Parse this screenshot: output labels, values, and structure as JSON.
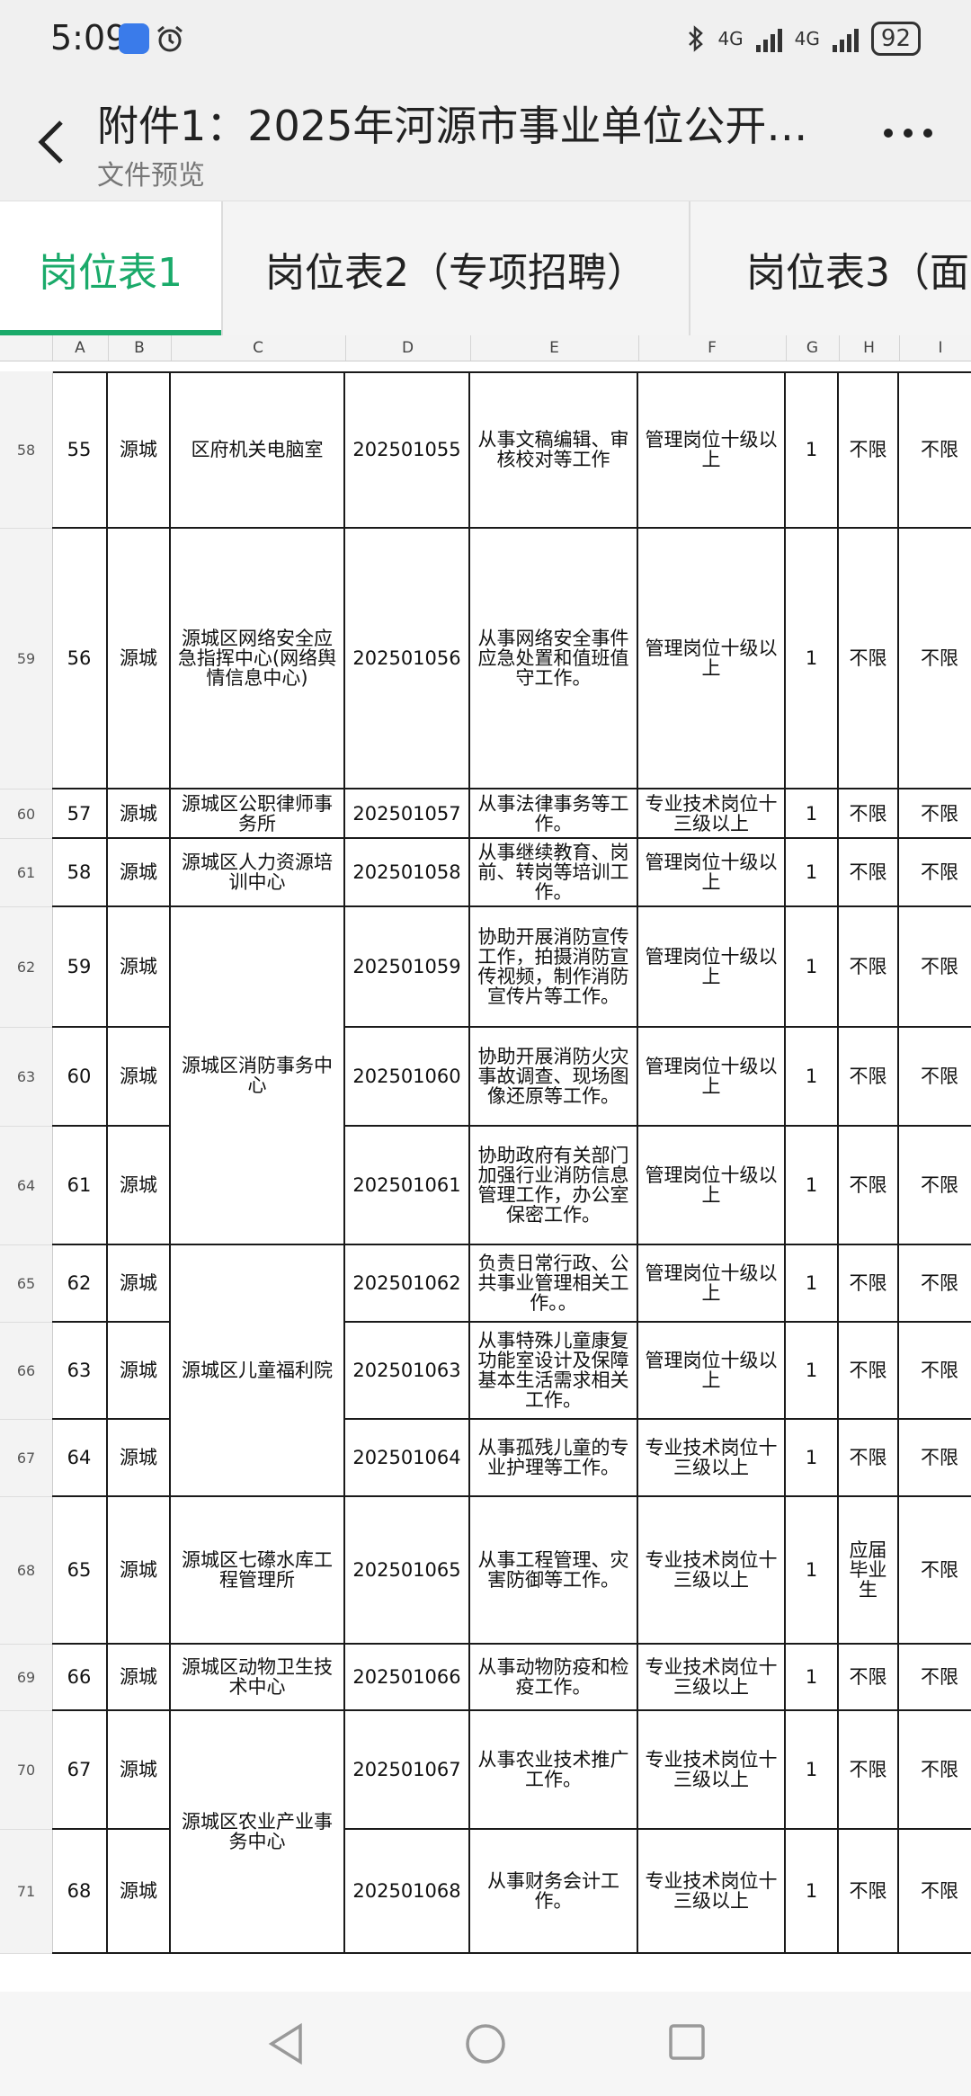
{
  "status": {
    "time": "5:09",
    "battery": "92",
    "net1": "4G",
    "net2": "4G"
  },
  "header": {
    "title": "附件1：2025年河源市事业单位公开…",
    "subtitle": "文件预览"
  },
  "tabs": [
    {
      "label": "岗位表1"
    },
    {
      "label": "岗位表2（专项招聘）"
    },
    {
      "label": "岗位表3（面"
    }
  ],
  "columns": [
    "A",
    "B",
    "C",
    "D",
    "E",
    "F",
    "G",
    "H",
    "I"
  ],
  "rows": [
    {
      "n": "58",
      "a": "55",
      "b": "源城",
      "c": "区府机关电脑室",
      "d": "202501055",
      "e": "从事文稿编辑、审核校对等工作",
      "f": "管理岗位十级以上",
      "g": "1",
      "h": "不限",
      "i": "不限"
    },
    {
      "n": "59",
      "a": "56",
      "b": "源城",
      "c": "源城区网络安全应急指挥中心(网络舆情信息中心)",
      "d": "202501056",
      "e": "从事网络安全事件应急处置和值班值守工作。",
      "f": "管理岗位十级以上",
      "g": "1",
      "h": "不限",
      "i": "不限"
    },
    {
      "n": "60",
      "a": "57",
      "b": "源城",
      "c": "源城区公职律师事务所",
      "d": "202501057",
      "e": "从事法律事务等工作。",
      "f": "专业技术岗位十三级以上",
      "g": "1",
      "h": "不限",
      "i": "不限"
    },
    {
      "n": "61",
      "a": "58",
      "b": "源城",
      "c": "源城区人力资源培训中心",
      "d": "202501058",
      "e": "从事继续教育、岗前、转岗等培训工作。",
      "f": "管理岗位十级以上",
      "g": "1",
      "h": "不限",
      "i": "不限"
    },
    {
      "n": "62",
      "a": "59",
      "b": "源城",
      "c": "",
      "d": "202501059",
      "e": "协助开展消防宣传工作，拍摄消防宣传视频，制作消防宣传片等工作。",
      "f": "管理岗位十级以上",
      "g": "1",
      "h": "不限",
      "i": "不限"
    },
    {
      "n": "63",
      "a": "60",
      "b": "源城",
      "c": "",
      "d": "202501060",
      "e": "协助开展消防火灾事故调查、现场图像还原等工作。",
      "f": "管理岗位十级以上",
      "g": "1",
      "h": "不限",
      "i": "不限"
    },
    {
      "n": "64",
      "a": "61",
      "b": "源城",
      "c": "",
      "d": "202501061",
      "e": "协助政府有关部门加强行业消防信息管理工作，办公室保密工作。",
      "f": "管理岗位十级以上",
      "g": "1",
      "h": "不限",
      "i": "不限"
    },
    {
      "n": "65",
      "a": "62",
      "b": "源城",
      "c": "",
      "d": "202501062",
      "e": "负责日常行政、公共事业管理相关工作。。",
      "f": "管理岗位十级以上",
      "g": "1",
      "h": "不限",
      "i": "不限"
    },
    {
      "n": "66",
      "a": "63",
      "b": "源城",
      "c": "",
      "d": "202501063",
      "e": "从事特殊儿童康复功能室设计及保障基本生活需求相关工作。",
      "f": "管理岗位十级以上",
      "g": "1",
      "h": "不限",
      "i": "不限"
    },
    {
      "n": "67",
      "a": "64",
      "b": "源城",
      "c": "",
      "d": "202501064",
      "e": "从事孤残儿童的专业护理等工作。",
      "f": "专业技术岗位十三级以上",
      "g": "1",
      "h": "不限",
      "i": "不限"
    },
    {
      "n": "68",
      "a": "65",
      "b": "源城",
      "c": "源城区七礤水库工程管理所",
      "d": "202501065",
      "e": "从事工程管理、灾害防御等工作。",
      "f": "专业技术岗位十三级以上",
      "g": "1",
      "h": "应届毕业生",
      "i": "不限"
    },
    {
      "n": "69",
      "a": "66",
      "b": "源城",
      "c": "源城区动物卫生技术中心",
      "d": "202501066",
      "e": "从事动物防疫和检疫工作。",
      "f": "专业技术岗位十三级以上",
      "g": "1",
      "h": "不限",
      "i": "不限"
    },
    {
      "n": "70",
      "a": "67",
      "b": "源城",
      "c": "",
      "d": "202501067",
      "e": "从事农业技术推广工作。",
      "f": "专业技术岗位十三级以上",
      "g": "1",
      "h": "不限",
      "i": "不限"
    },
    {
      "n": "71",
      "a": "68",
      "b": "源城",
      "c": "",
      "d": "202501068",
      "e": "从事财务会计工作。",
      "f": "专业技术岗位十三级以上",
      "g": "1",
      "h": "不限",
      "i": "不限"
    }
  ],
  "merged": [
    {
      "label": "源城区消防事务中心"
    },
    {
      "label": "源城区儿童福利院"
    },
    {
      "label": "源城区农业产业事务中心"
    }
  ]
}
